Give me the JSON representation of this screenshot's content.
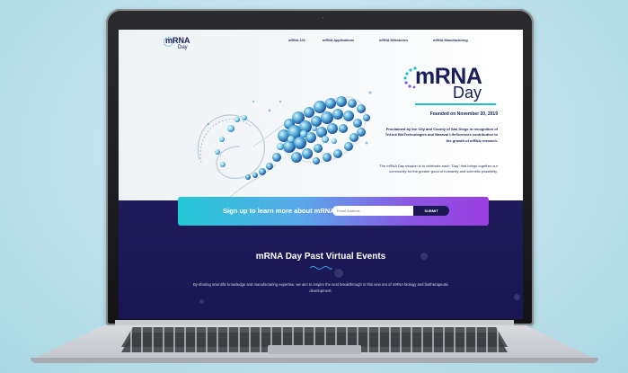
{
  "site": {
    "logo_text": "mRNA",
    "logo_sub": "Day",
    "nav": [
      "mRNA 101",
      "mRNA Applications",
      "mRNA Milestones",
      "mRNA Manufacturing"
    ],
    "hero": {
      "logo_text": "mRNA",
      "logo_sub": "Day",
      "founded": "Founded on November 20, 2019",
      "proclaimed": "Proclaimed by the City and County of San Diego in recognition of TriLink BioTechnologies and Maravai LifeSciences contribution to the growth of mRNA research.",
      "mission": "The mRNA Day mission is to celebrate each \"Day\" that brings together our community for the greater good of humanity and scientific possibility."
    },
    "signup": {
      "label": "Sign up to learn more about mRNA",
      "placeholder": "Email Address",
      "submit": "SUBMIT"
    },
    "events": {
      "title": "mRNA Day Past Virtual Events",
      "text": "By sharing scientific knowledge and manufacturing expertise, we aim to inspire the next breakthrough in this new era of mRNA biology and biotherapeutic development."
    }
  },
  "colors": {
    "navy": "#1a1f5a",
    "teal": "#1dc0c4",
    "purple": "#9a3fe0",
    "dark_section": "#1e1b5a"
  }
}
